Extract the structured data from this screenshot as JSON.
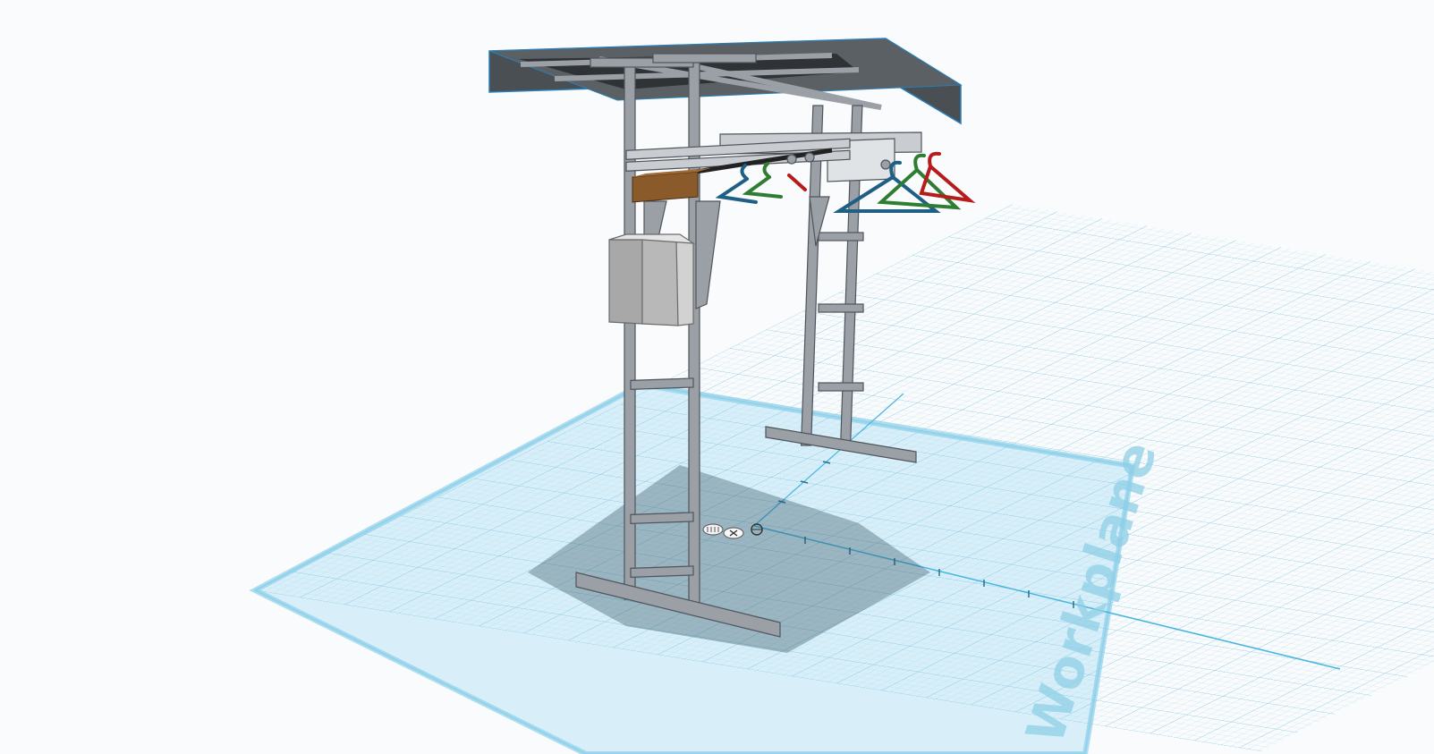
{
  "workplane": {
    "label": "Workplane"
  },
  "model": {
    "name": "clothing-rack-assembly",
    "colors": {
      "frame": "#9aa0a6",
      "frame_edge": "#4f555b",
      "roof": "#3f4448",
      "roof_edge": "#2a7fb8",
      "shelf": "#8a5a2b",
      "box": "#a8a8a8",
      "hanger_blue": "#1f5f86",
      "hanger_green": "#2e7d32",
      "hanger_red": "#b71c1c",
      "grid_fill": "#d6eef8",
      "grid_line": "#7ec8e3",
      "axis": "#47b5e0"
    }
  },
  "view_controls": {
    "items": [
      {
        "icon": "grid-toggle-icon"
      },
      {
        "icon": "center-view-icon"
      },
      {
        "icon": "snap-target-icon"
      }
    ]
  }
}
